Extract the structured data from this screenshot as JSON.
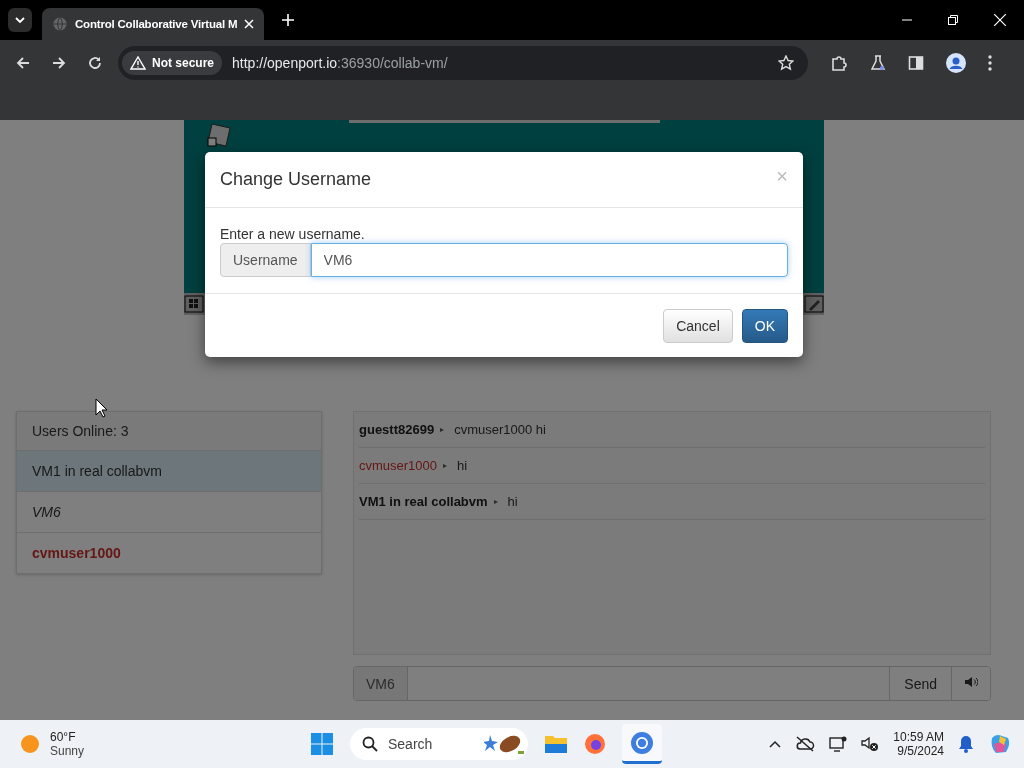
{
  "browser": {
    "tab_title": "Control Collaborative Virtual M",
    "security": "Not secure",
    "url_host": "http://openport.io",
    "url_rest": ":36930/collab-vm/"
  },
  "modal": {
    "title": "Change Username",
    "close": "×",
    "prompt": "Enter a new username.",
    "addon": "Username",
    "value": "VM6",
    "buttons": [
      {
        "label": "Cancel",
        "kind": "default"
      },
      {
        "label": "OK",
        "kind": "primary"
      }
    ]
  },
  "users": {
    "header": "Users Online: 3",
    "items": [
      {
        "name": "VM1 in real collabvm",
        "selected": true,
        "kind": "normal"
      },
      {
        "name": "VM6",
        "selected": false,
        "kind": "self"
      },
      {
        "name": "cvmuser1000",
        "selected": false,
        "kind": "admin"
      }
    ]
  },
  "chat": {
    "messages": [
      {
        "user": "guestt82699",
        "text": "cvmuser1000 hi",
        "kind": "normal"
      },
      {
        "user": "cvmuser1000",
        "text": "hi",
        "kind": "admin"
      },
      {
        "user": "VM1 in real collabvm",
        "text": "hi",
        "kind": "normal"
      }
    ],
    "username": "VM6",
    "send": "Send"
  },
  "taskbar": {
    "temperature": "60°F",
    "condition": "Sunny",
    "search": "Search",
    "time": "10:59 AM",
    "date": "9/5/2024"
  }
}
